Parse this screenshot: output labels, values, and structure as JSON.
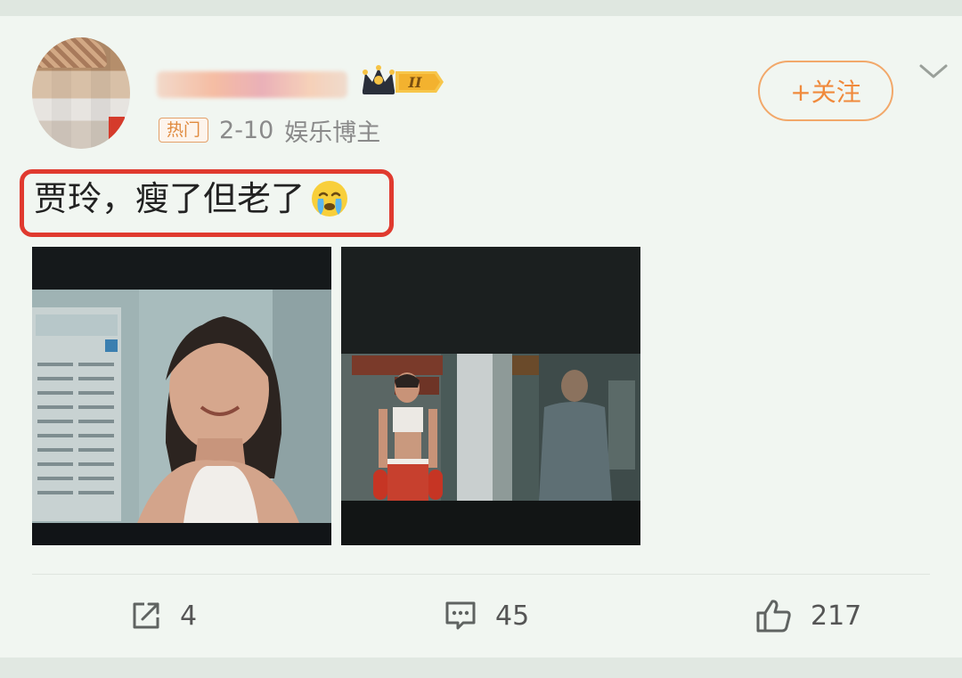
{
  "post": {
    "badge": "热门",
    "date": "2-10",
    "author_role": "娱乐博主",
    "level": "II",
    "follow_label": "+关注",
    "text": "贾玲，瘦了但老了"
  },
  "actions": {
    "repost_count": "4",
    "comment_count": "45",
    "like_count": "217"
  },
  "icons": [
    "crown-icon",
    "chevron-down-icon",
    "crying-emoji-icon",
    "share-icon",
    "comment-icon",
    "like-icon"
  ],
  "colors": {
    "accent_orange": "#f08a3c",
    "highlight_red": "#e03a2f",
    "card_bg": "#f1f6f1"
  }
}
